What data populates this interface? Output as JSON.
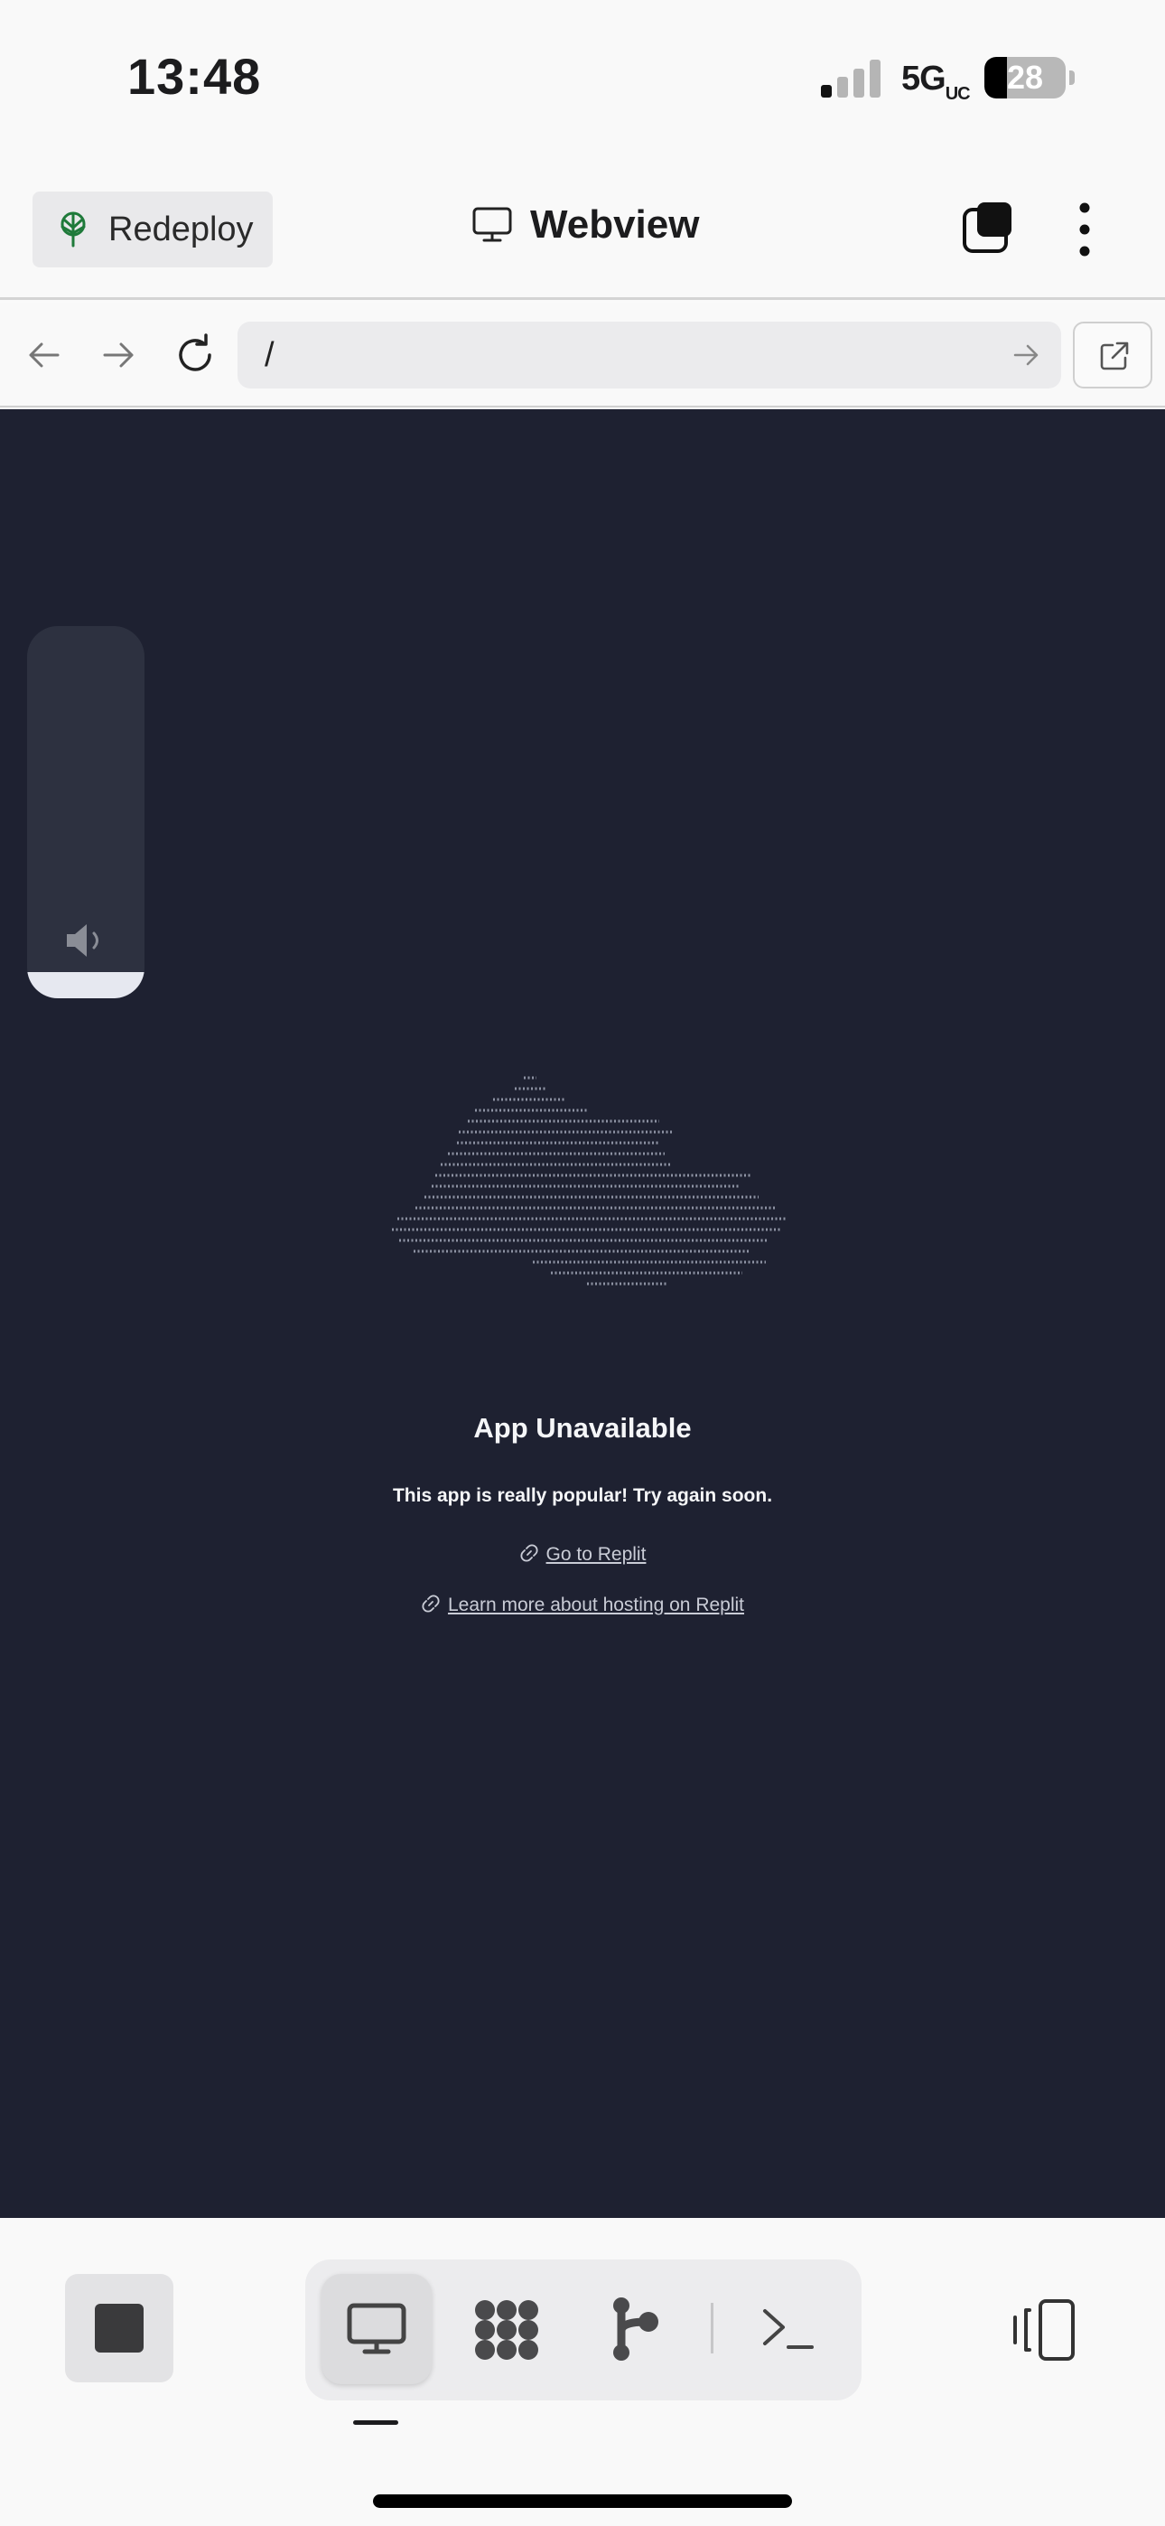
{
  "status_bar": {
    "time": "13:48",
    "network": "5G",
    "network_suffix": "UC",
    "battery_level": "28",
    "battery_fraction": 0.28
  },
  "header": {
    "redeploy_label": "Redeploy",
    "tab_title": "Webview",
    "accent_color": "#1f7a3a"
  },
  "browser": {
    "url": "/"
  },
  "webview": {
    "background_color": "#1e2131",
    "volume_level": 0.07,
    "title": "App Unavailable",
    "message": "This app is really popular! Try again soon.",
    "links": [
      {
        "label": "Go to Replit",
        "icon": "link-icon"
      },
      {
        "label": "Learn more about hosting on Replit",
        "icon": "link-icon"
      }
    ]
  },
  "toolbar": {
    "tools": [
      {
        "name": "webview",
        "icon": "monitor-icon",
        "active": true
      },
      {
        "name": "workspace",
        "icon": "grid-blobs-icon",
        "active": false
      },
      {
        "name": "git",
        "icon": "git-branch-icon",
        "active": false
      },
      {
        "name": "shell",
        "icon": "terminal-icon",
        "active": false
      }
    ]
  }
}
